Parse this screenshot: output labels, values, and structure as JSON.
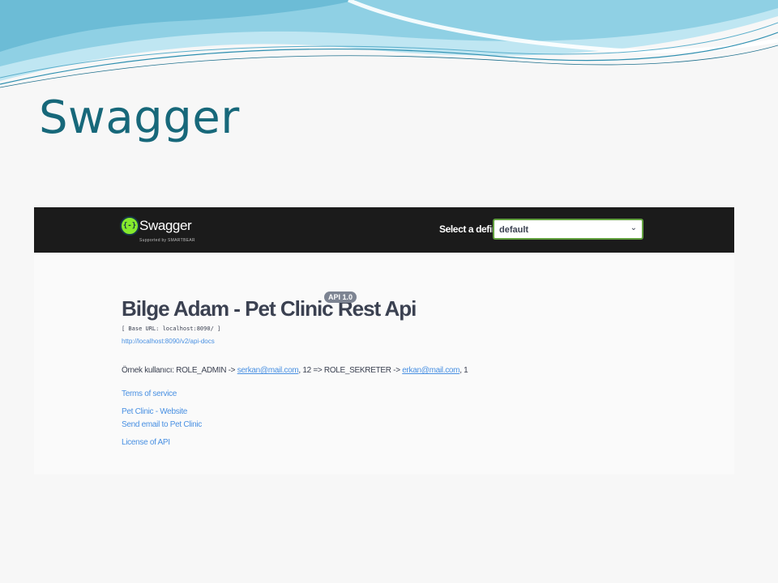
{
  "slide": {
    "title": "Swagger",
    "colors": {
      "title": "#17687a",
      "wave_light": "#bfe6f2",
      "wave_mid": "#7cc8df",
      "wave_dark": "#2e8fb0"
    }
  },
  "swagger": {
    "logo_text": "Swagger",
    "logo_sub": "Supported by SMARTBEAR",
    "logo_icon": "swagger-braces-icon",
    "definition_label": "Select a definition",
    "definition_value": "default",
    "api_title": "Bilge Adam - Pet Clinic Rest Api",
    "version": "API 1.0",
    "base_url": "[ Base URL: localhost:8090/ ]",
    "api_docs_link": "http://localhost:8090/v2/api-docs",
    "description": {
      "prefix": "Örnek kullanıcı: ROLE_ADMIN -> ",
      "admin_email": "serkan@mail.com",
      "middle": ", 12 => ROLE_SEKRETER -> ",
      "sekreter_email": "erkan@mail.com",
      "suffix": ", 1"
    },
    "links": {
      "terms": "Terms of service",
      "website": "Pet Clinic - Website",
      "email": "Send email to Pet Clinic",
      "license": "License of API"
    },
    "colors": {
      "topbar": "#1b1b1b",
      "accent": "#85ea2d",
      "link": "#4990e2",
      "text": "#3b4151"
    }
  }
}
